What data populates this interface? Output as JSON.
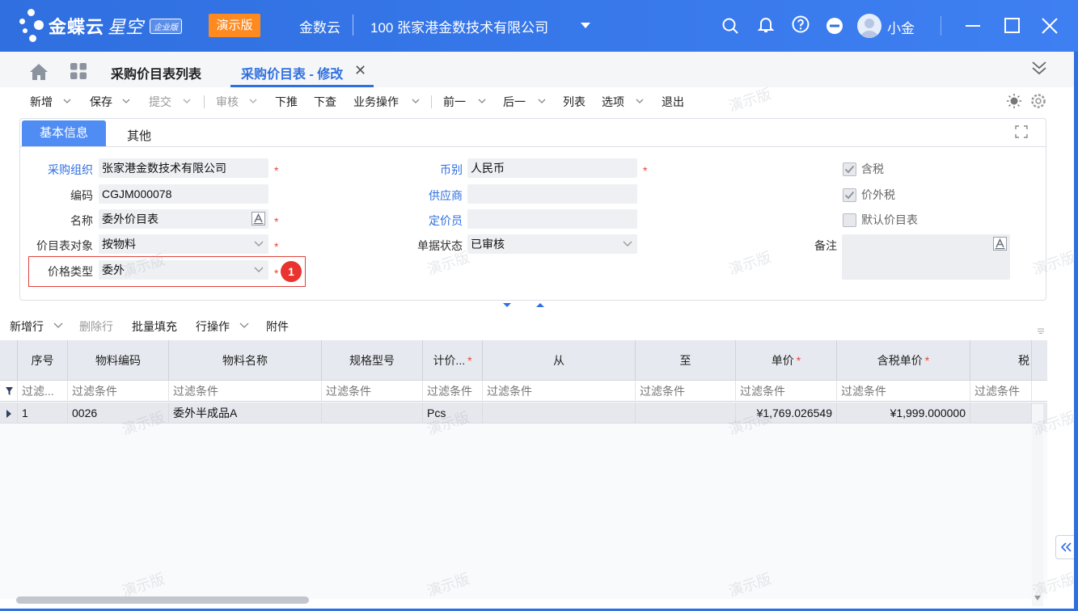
{
  "app": {
    "brand": "金蝶云",
    "brand_sub": "星空",
    "edition": "企业版",
    "demo_label": "演示版",
    "app_name": "金数云",
    "company": "100  张家港金数技术有限公司",
    "user_name": "小金"
  },
  "tabs": {
    "list_tab": "采购价目表列表",
    "edit_tab": "采购价目表 - 修改"
  },
  "toolbar": {
    "new": "新增",
    "save": "保存",
    "submit": "提交",
    "audit": "审核",
    "push_down": "下推",
    "query_down": "下查",
    "biz_ops": "业务操作",
    "prev": "前一",
    "next": "后一",
    "list": "列表",
    "options": "选项",
    "exit": "退出"
  },
  "form_tabs": {
    "basic": "基本信息",
    "other": "其他"
  },
  "form": {
    "purchase_org_label": "采购组织",
    "purchase_org_value": "张家港金数技术有限公司",
    "code_label": "编码",
    "code_value": "CGJM000078",
    "name_label": "名称",
    "name_value": "委外价目表",
    "target_label": "价目表对象",
    "target_value": "按物料",
    "price_type_label": "价格类型",
    "price_type_value": "委外",
    "currency_label": "币别",
    "currency_value": "人民币",
    "supplier_label": "供应商",
    "supplier_value": "",
    "pricer_label": "定价员",
    "pricer_value": "",
    "status_label": "单据状态",
    "status_value": "已审核",
    "tax_incl_label": "含税",
    "tax_extra_label": "价外税",
    "default_label": "默认价目表",
    "remark_label": "备注",
    "required_mark": "*",
    "badge": "1"
  },
  "grid_toolbar": {
    "add_row": "新增行",
    "delete_row": "删除行",
    "batch_fill": "批量填充",
    "row_ops": "行操作",
    "attachment": "附件"
  },
  "grid": {
    "columns": [
      "序号",
      "物料编码",
      "物料名称",
      "规格型号",
      "计价...",
      "从",
      "至",
      "单价",
      "含税单价",
      "税"
    ],
    "filter_first": "过滤...",
    "filter_text": "过滤条件",
    "rows": [
      {
        "seq": "1",
        "code": "0026",
        "name": "委外半成品A",
        "spec": "",
        "unit": "Pcs",
        "from": "",
        "to": "",
        "price": "¥1,769.026549",
        "tax_price": "¥1,999.000000",
        "tax": ""
      }
    ]
  },
  "watermark": "演示版",
  "colors": {
    "brand": "#2f6fe0",
    "demo": "#ff8a1f",
    "required": "#e43",
    "highlight": "#e0413c"
  }
}
